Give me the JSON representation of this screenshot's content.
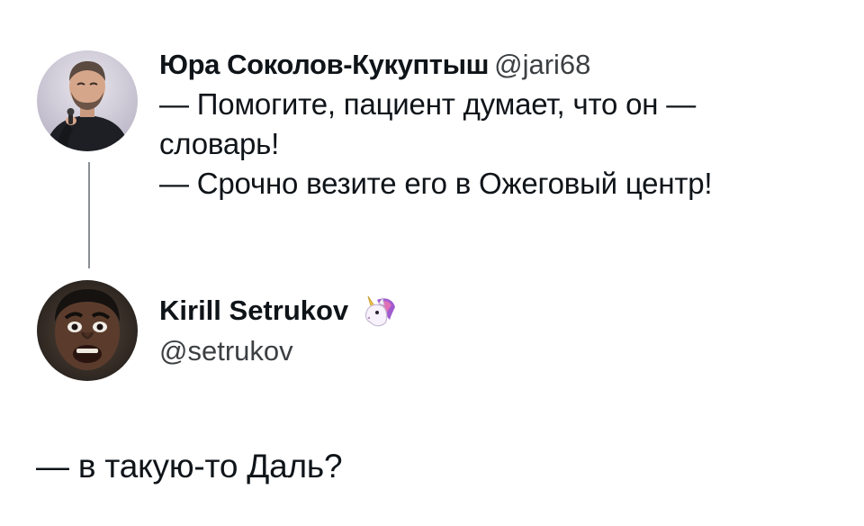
{
  "tweet_1": {
    "author": {
      "display_name": "Юра Соколов-Кукуптыш",
      "handle": "@jari68",
      "avatar_icon": "avatar-man-with-microphone"
    },
    "text_lines": [
      "— Помогите, пациент думает, что он —",
      "словарь!",
      "— Срочно везите его в Ожеговый центр!"
    ]
  },
  "tweet_2": {
    "author": {
      "display_name": "Kirill Setrukov",
      "handle": "@setrukov",
      "badge_icon": "unicorn-icon",
      "avatar_icon": "avatar-man-surprised"
    },
    "text": "— в такую-то Даль?"
  },
  "colors": {
    "text": "#0f1419",
    "handle": "#3c4043",
    "thread_line": "#8b8f94",
    "background": "#ffffff"
  }
}
